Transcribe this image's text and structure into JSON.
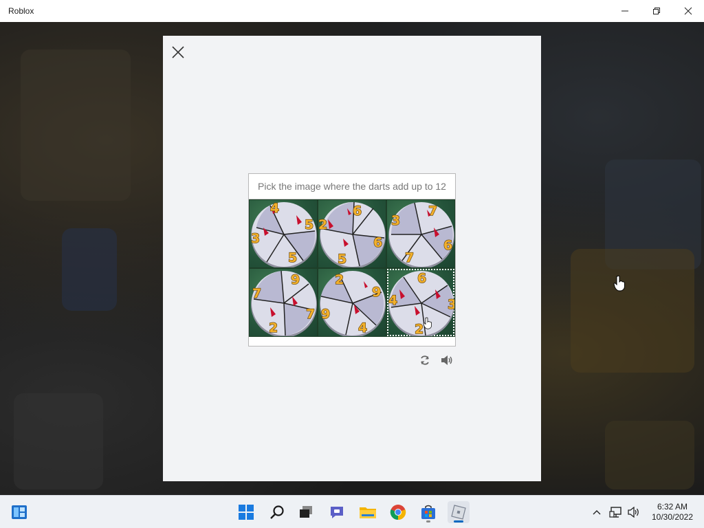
{
  "window": {
    "title": "Roblox",
    "icons": [
      "minimize-icon",
      "maximize-icon",
      "close-icon"
    ]
  },
  "dialog": {
    "close_icon": "close-icon"
  },
  "captcha": {
    "prompt": "Pick the image where the darts add up to 12",
    "tiles": [
      {
        "numbers": [
          "4",
          "5",
          "3",
          "5"
        ]
      },
      {
        "numbers": [
          "6",
          "2",
          "6",
          "5"
        ]
      },
      {
        "numbers": [
          "3",
          "7",
          "6",
          "7"
        ]
      },
      {
        "numbers": [
          "9",
          "7",
          "7",
          "2"
        ]
      },
      {
        "numbers": [
          "2",
          "9",
          "9",
          "4"
        ]
      },
      {
        "numbers": [
          "6",
          "4",
          "3",
          "2"
        ]
      }
    ],
    "selected_tile": 6,
    "tools": [
      "refresh-icon",
      "audio-icon"
    ]
  },
  "taskbar": {
    "apps": [
      "start-icon",
      "search-icon",
      "task-view-icon",
      "chat-icon",
      "file-explorer-icon",
      "chrome-icon",
      "store-icon",
      "roblox-icon"
    ],
    "tray": [
      "show-hidden-icons",
      "network-icon",
      "volume-icon"
    ],
    "time": "6:32 AM",
    "date": "10/30/2022"
  },
  "colors": {
    "accent": "#0067c0",
    "number": "#f2b02c",
    "dart": "#c8102e",
    "board": "#2b5a3c"
  }
}
